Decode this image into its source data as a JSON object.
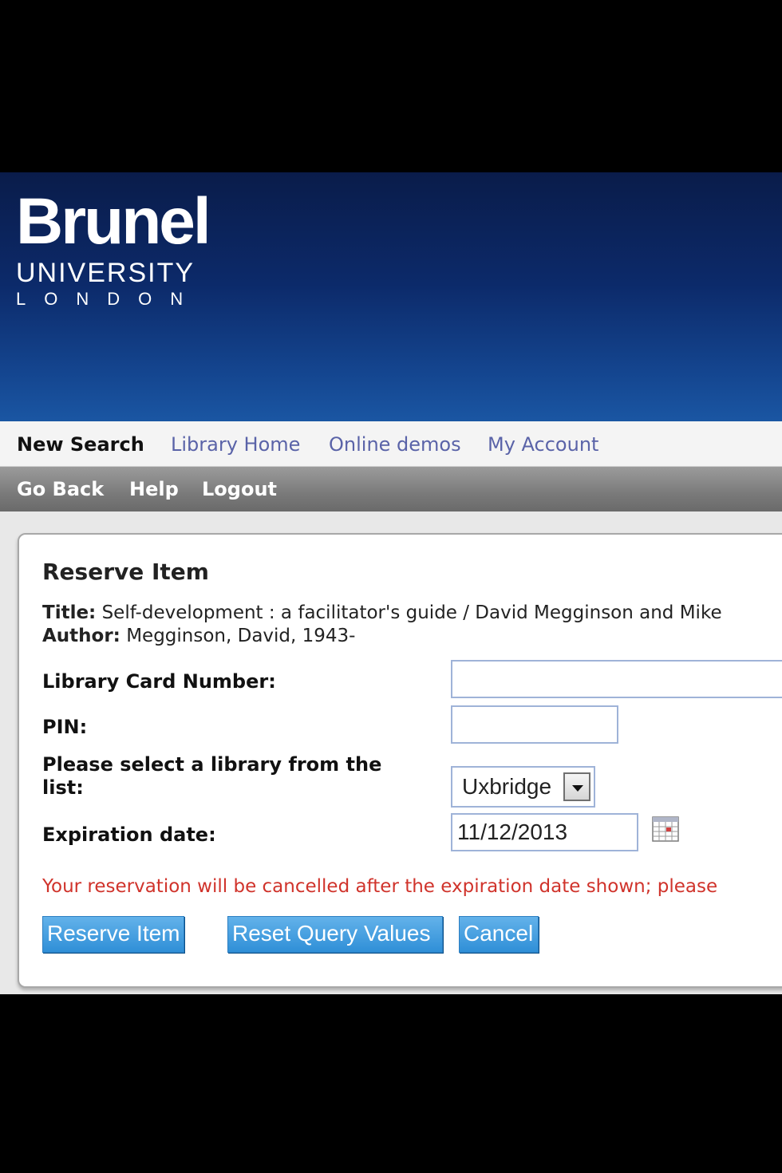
{
  "brand": {
    "name": "Brunel",
    "line2": "UNIVERSITY",
    "line3": "LONDON"
  },
  "nav_primary": {
    "new_search": "New Search",
    "library_home": "Library Home",
    "online_demos": "Online demos",
    "my_account": "My Account"
  },
  "nav_secondary": {
    "go_back": "Go Back",
    "help": "Help",
    "logout": "Logout"
  },
  "form": {
    "heading": "Reserve Item",
    "title_label": "Title:",
    "title_value": "Self-development : a facilitator's guide / David Megginson and Mike",
    "author_label": "Author:",
    "author_value": "Megginson, David, 1943-",
    "card_label": "Library Card Number:",
    "card_value": "",
    "pin_label": "PIN:",
    "pin_value": "",
    "library_label": "Please select a library from the list:",
    "library_selected": "Uxbridge",
    "expiration_label": "Expiration date:",
    "expiration_value": "11/12/2013",
    "notice": "Your reservation will be cancelled after the expiration date shown; please"
  },
  "buttons": {
    "reserve": "Reserve Item",
    "reset": "Reset Query Values",
    "cancel": "Cancel"
  },
  "colors": {
    "banner": "#0c2a6a",
    "link": "#5a63a8",
    "notice": "#d0332b",
    "button": "#2f8fd7"
  },
  "icons": {
    "calendar": "calendar-icon",
    "dropdown": "chevron-down-icon"
  }
}
